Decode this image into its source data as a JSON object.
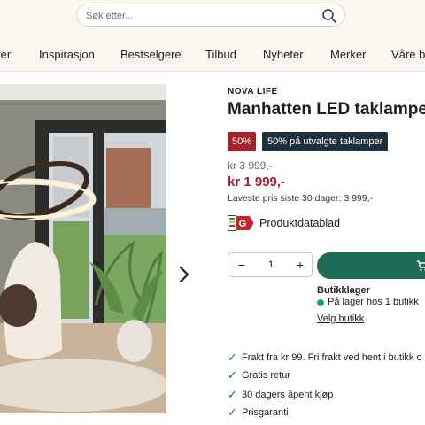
{
  "search": {
    "placeholder": "Søk etter..."
  },
  "nav": [
    {
      "label": "ter"
    },
    {
      "label": "Inspirasjon"
    },
    {
      "label": "Bestselgere"
    },
    {
      "label": "Tilbud"
    },
    {
      "label": "Nyheter"
    },
    {
      "label": "Merker"
    },
    {
      "label": "Våre b"
    }
  ],
  "product": {
    "brand": "NOVA LIFE",
    "title": "Manhatten LED taklampe",
    "discount_badge": "50%",
    "promo_badge": "50% på utvalgte taklamper",
    "old_price": "kr 3 999,-",
    "price": "kr 1 999,-",
    "lowest_price": "Laveste pris siste 30 dager: 3 999,-",
    "energy_class": "G",
    "datasheet_label": "Produktdatablad"
  },
  "purchase": {
    "minus": "−",
    "quantity": "1",
    "plus": "+"
  },
  "stock": {
    "title": "Butikklager",
    "status": "På lager hos 1 butikk",
    "link": "Velg butikk"
  },
  "usps": [
    {
      "check": "✓",
      "text": "Frakt fra kr 99. Fri frakt ved hent i butikk o"
    },
    {
      "check": "✓",
      "text": "Gratis retur"
    },
    {
      "check": "✓",
      "text": "30 dagers åpent kjøp"
    },
    {
      "check": "✓",
      "text": "Prisgaranti"
    }
  ],
  "colors": {
    "header_bg": "#fbf6ef",
    "price_red": "#a3202d",
    "promo_navy": "#1f2f3d",
    "brand_green": "#1d6b54",
    "stock_green": "#2e9a5f"
  },
  "icons": [
    "search-icon",
    "chevron-right-icon",
    "energy-label-icon",
    "cart-icon",
    "check-icon"
  ]
}
